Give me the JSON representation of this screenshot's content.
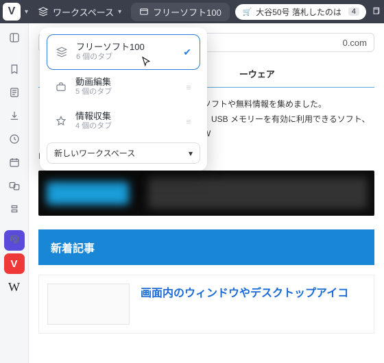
{
  "topbar": {
    "workspace_label": "ワークスペース",
    "active_tab": "フリーソフト100",
    "news_text": "大谷50号 落札したのは",
    "news_badge": "4"
  },
  "workspaces": {
    "items": [
      {
        "name": "フリーソフト100",
        "sub": "6 個のタブ",
        "active": true
      },
      {
        "name": "動画編集",
        "sub": "5 個のタブ",
        "active": false
      },
      {
        "name": "情報収集",
        "sub": "4 個のタブ",
        "active": false
      }
    ],
    "new_label": "新しいワークスペース"
  },
  "page": {
    "url_fragment": "0.com",
    "title_fragment": "ーウェア",
    "sub1_fragment": "ソフトや無料情報を集めました。",
    "sub2_fragment": "、USB メモリーを有効に利用できるソフト、W",
    "breadcrumb": "HOME",
    "section_heading": "新着記事",
    "article_title": "画面内のウィンドウやデスクトップアイコ"
  }
}
